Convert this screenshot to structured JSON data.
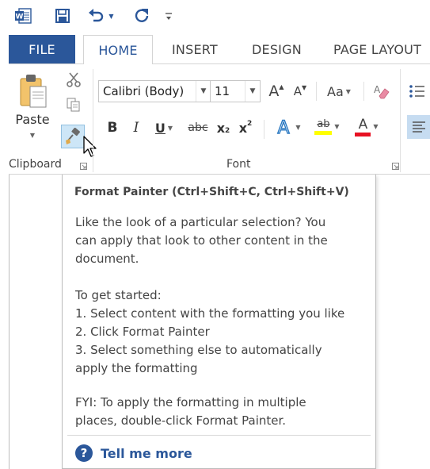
{
  "tabs": {
    "file": "FILE",
    "home": "HOME",
    "insert": "INSERT",
    "design": "DESIGN",
    "page_layout": "PAGE LAYOUT"
  },
  "clipboard": {
    "paste_label": "Paste",
    "group_label": "Clipboard"
  },
  "font": {
    "family": "Calibri (Body)",
    "size": "11",
    "change_case": "Aa",
    "group_label": "Font",
    "bold": "B",
    "italic": "I",
    "underline": "U",
    "strikethrough": "abc",
    "subscript": "x",
    "superscript": "x",
    "grow": "A",
    "shrink": "A",
    "highlight_label": "ab",
    "font_color_label": "A"
  },
  "tooltip": {
    "title": "Format Painter (Ctrl+Shift+C, Ctrl+Shift+V)",
    "lines": [
      "Like the look of a particular selection? You",
      "can apply that look to other content in the",
      "document.",
      "To get started:",
      "1. Select content with the formatting you like",
      "2. Click Format Painter",
      "3. Select something else to automatically",
      "apply the formatting",
      "FYI: To apply the formatting in multiple",
      "places, double-click Format Painter."
    ],
    "link": "Tell me more"
  },
  "colors": {
    "accent": "#2b579a",
    "highlight": "#ffff00",
    "font_color": "#e81123"
  }
}
